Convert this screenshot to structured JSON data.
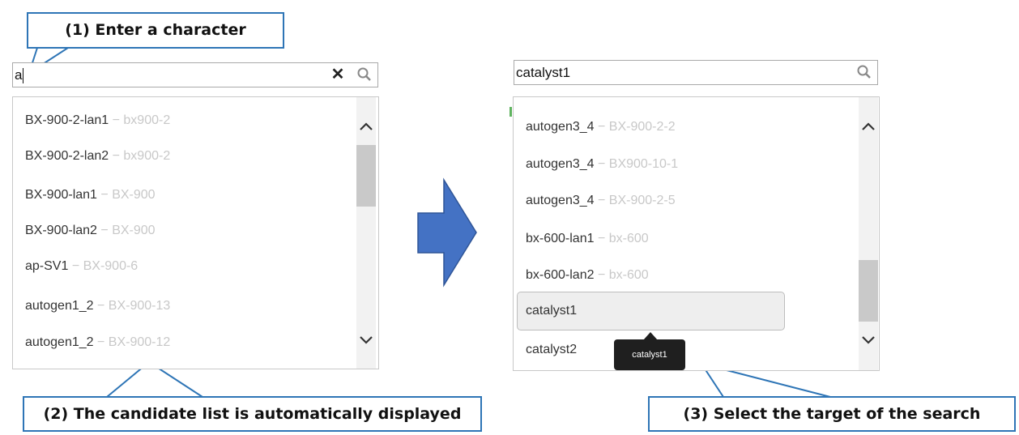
{
  "steps": {
    "step1": "(1) Enter a character",
    "step2": "(2) The candidate list is automatically displayed",
    "step3": "(3) Select the target of the search"
  },
  "left_panel": {
    "search_value": "a",
    "items": [
      {
        "name": "BX-900-2-lan1",
        "parent": "bx900-2"
      },
      {
        "name": "BX-900-2-lan2",
        "parent": "bx900-2"
      },
      {
        "name": "BX-900-lan1",
        "parent": "BX-900"
      },
      {
        "name": "BX-900-lan2",
        "parent": "BX-900"
      },
      {
        "name": "ap-SV1",
        "parent": "BX-900-6"
      },
      {
        "name": "autogen1_2",
        "parent": "BX-900-13"
      },
      {
        "name": "autogen1_2",
        "parent": "BX-900-12"
      }
    ]
  },
  "right_panel": {
    "search_value": "catalyst1",
    "items": [
      {
        "name": "autogen3_4",
        "parent": "BX-900-2-2"
      },
      {
        "name": "autogen3_4",
        "parent": "BX900-10-1"
      },
      {
        "name": "autogen3_4",
        "parent": "BX-900-2-5"
      },
      {
        "name": "bx-600-lan1",
        "parent": "bx-600"
      },
      {
        "name": "bx-600-lan2",
        "parent": "bx-600"
      }
    ],
    "selected_item": "catalyst1",
    "next_item": "catalyst2",
    "tooltip": "catalyst1"
  },
  "colors": {
    "callout_border": "#2e75b6",
    "arrow_fill": "#4472c4",
    "secondary_text": "#c8c8c8",
    "tooltip_bg": "#1f1f1f"
  },
  "icons": {
    "clear": "close-icon",
    "search": "magnifier-icon",
    "scroll_up": "chevron-up-icon",
    "scroll_down": "chevron-down-icon",
    "flow": "right-arrow-icon"
  }
}
